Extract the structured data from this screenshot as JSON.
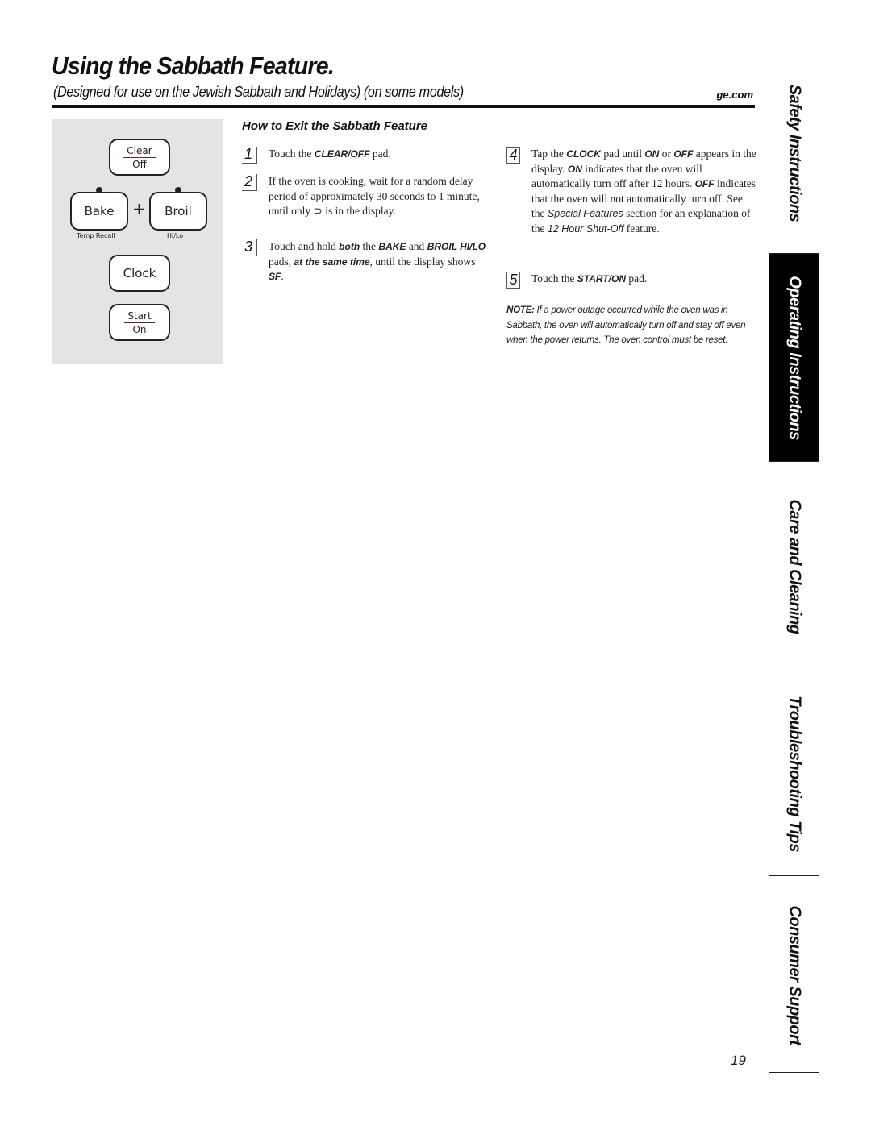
{
  "header": {
    "title": "Using the Sabbath Feature.",
    "subtitle": "(Designed for use on the Jewish Sabbath and Holidays) (on some models)",
    "site_link": "ge.com"
  },
  "control_panel": {
    "clear_pad": {
      "top": "Clear",
      "bottom": "Off"
    },
    "bake_pad": {
      "label": "Bake",
      "sublabel": "Temp Recall"
    },
    "plus": "+",
    "broil_pad": {
      "label": "Broil",
      "sublabel": "Hi/Lo"
    },
    "clock_pad": {
      "label": "Clock"
    },
    "start_pad": {
      "top": "Start",
      "bottom": "On"
    }
  },
  "section": {
    "heading": "How to Exit the Sabbath Feature",
    "steps": [
      {
        "number": "1",
        "parts": [
          [
            "t",
            "Touch the "
          ],
          [
            "b",
            "CLEAR/OFF"
          ],
          [
            "t",
            " pad."
          ]
        ]
      },
      {
        "number": "2",
        "parts": [
          [
            "t",
            "If the oven is cooking, wait for a random delay period of approximately 30 seconds to 1 minute, until only ⊃ is in the display."
          ]
        ]
      },
      {
        "number": "3",
        "parts": [
          [
            "t",
            "Touch and hold "
          ],
          [
            "b",
            "both"
          ],
          [
            "t",
            " the "
          ],
          [
            "b",
            "BAKE"
          ],
          [
            "t",
            " and "
          ],
          [
            "b",
            "BROIL HI/LO"
          ],
          [
            "t",
            " pads, "
          ],
          [
            "b",
            "at the same time"
          ],
          [
            "t",
            ", until the display shows "
          ],
          [
            "b",
            "SF"
          ],
          [
            "t",
            "."
          ]
        ]
      },
      {
        "number": "4",
        "parts": [
          [
            "t",
            "Tap the "
          ],
          [
            "b",
            "CLOCK"
          ],
          [
            "t",
            " pad until "
          ],
          [
            "b",
            "ON"
          ],
          [
            "t",
            " or "
          ],
          [
            "b",
            "OFF"
          ],
          [
            "t",
            " appears in the display. "
          ],
          [
            "b",
            "ON"
          ],
          [
            "t",
            " indicates that the oven will automatically turn off after 12 hours. "
          ],
          [
            "b",
            "OFF"
          ],
          [
            "t",
            " indicates that the oven will not automatically turn off. See the "
          ],
          [
            "i",
            "Special Features"
          ],
          [
            "t",
            " section for an explanation of the "
          ],
          [
            "i",
            "12 Hour Shut-Off"
          ],
          [
            "t",
            " feature."
          ]
        ]
      },
      {
        "number": "5",
        "parts": [
          [
            "t",
            "Touch the "
          ],
          [
            "b",
            "START/ON"
          ],
          [
            "t",
            " pad."
          ]
        ]
      }
    ],
    "note_label": "NOTE:",
    "note_text": " If a power outage occurred while the oven was in Sabbath, the oven will automatically turn off and stay off even when the power returns. The oven control must be reset."
  },
  "sidebar": {
    "tabs": [
      {
        "label": "Safety Instructions",
        "active": false
      },
      {
        "label": "Operating Instructions",
        "active": true
      },
      {
        "label": "Care and Cleaning",
        "active": false
      },
      {
        "label": "Troubleshooting Tips",
        "active": false
      },
      {
        "label": "Consumer Support",
        "active": false
      }
    ]
  },
  "page_number": "19"
}
